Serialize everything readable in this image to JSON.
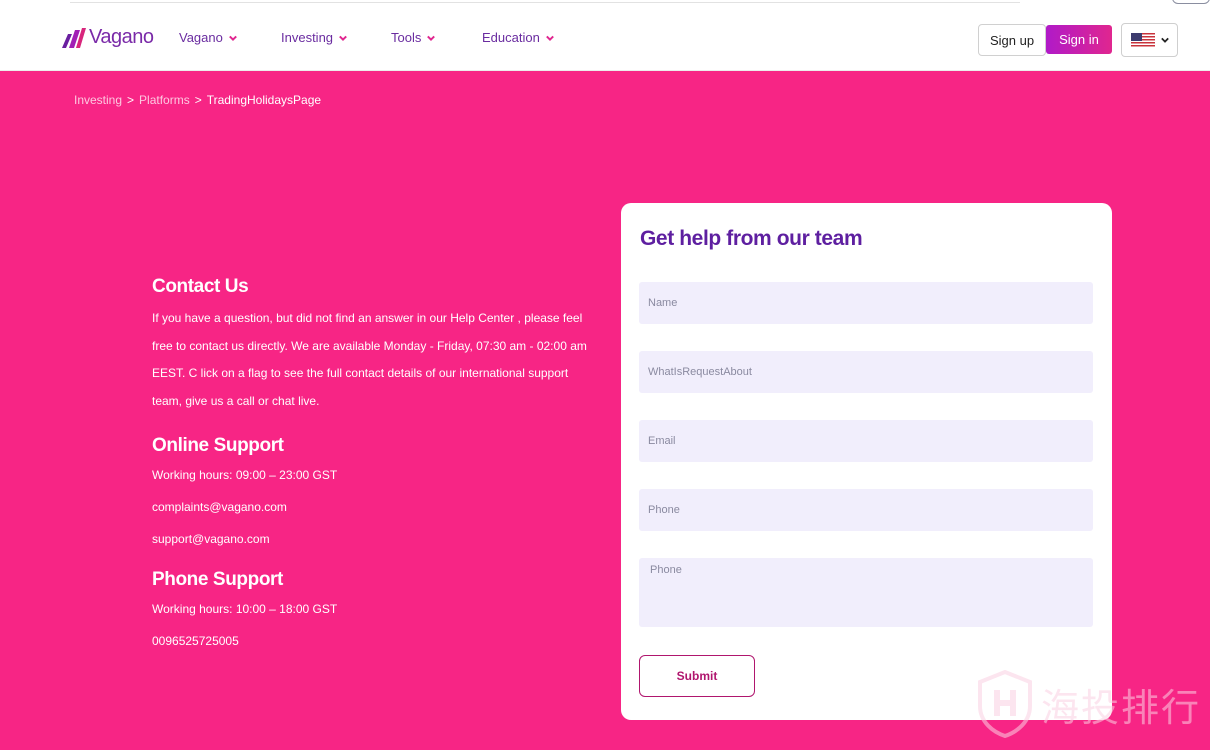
{
  "header": {
    "logo_text": "Vagano",
    "nav": [
      {
        "label": "Vagano"
      },
      {
        "label": "Investing"
      },
      {
        "label": "Tools"
      },
      {
        "label": "Education"
      }
    ],
    "signup_label": "Sign up",
    "signin_label": "Sign in",
    "language_icon": "us-flag-icon"
  },
  "breadcrumb": {
    "items": [
      "Investing",
      "Platforms",
      "TradingHolidaysPage"
    ],
    "separator": ">"
  },
  "contact": {
    "title": "Contact Us",
    "body": "If you have a question, but did not find an answer in our Help Center , please feel free to contact us directly. We are available Monday - Friday, 07:30 am - 02:00 am EEST. C lick on a flag to see the full contact details of our international support team, give us a call or chat live.",
    "online": {
      "title": "Online Support",
      "hours": "Working hours: 09:00 – 23:00 GST",
      "email1": "complaints@vagano.com",
      "email2": "support@vagano.com"
    },
    "phone": {
      "title": "Phone Support",
      "hours": "Working hours: 10:00 – 18:00 GST",
      "number": "0096525725005"
    }
  },
  "form": {
    "title": "Get help from our team",
    "name_placeholder": "Name",
    "request_placeholder": "WhatIsRequestAbout",
    "email_placeholder": "Email",
    "phone_placeholder": "Phone",
    "message_placeholder": "Phone",
    "submit_label": "Submit"
  },
  "watermark": {
    "text": "海投排行"
  },
  "colors": {
    "background": "#f72585",
    "brand_purple": "#6a2ca0",
    "signin_gradient_start": "#b01ac8",
    "signin_gradient_end": "#e0268f",
    "field_bg": "#f1eefc",
    "submit_border": "#b0166e"
  }
}
